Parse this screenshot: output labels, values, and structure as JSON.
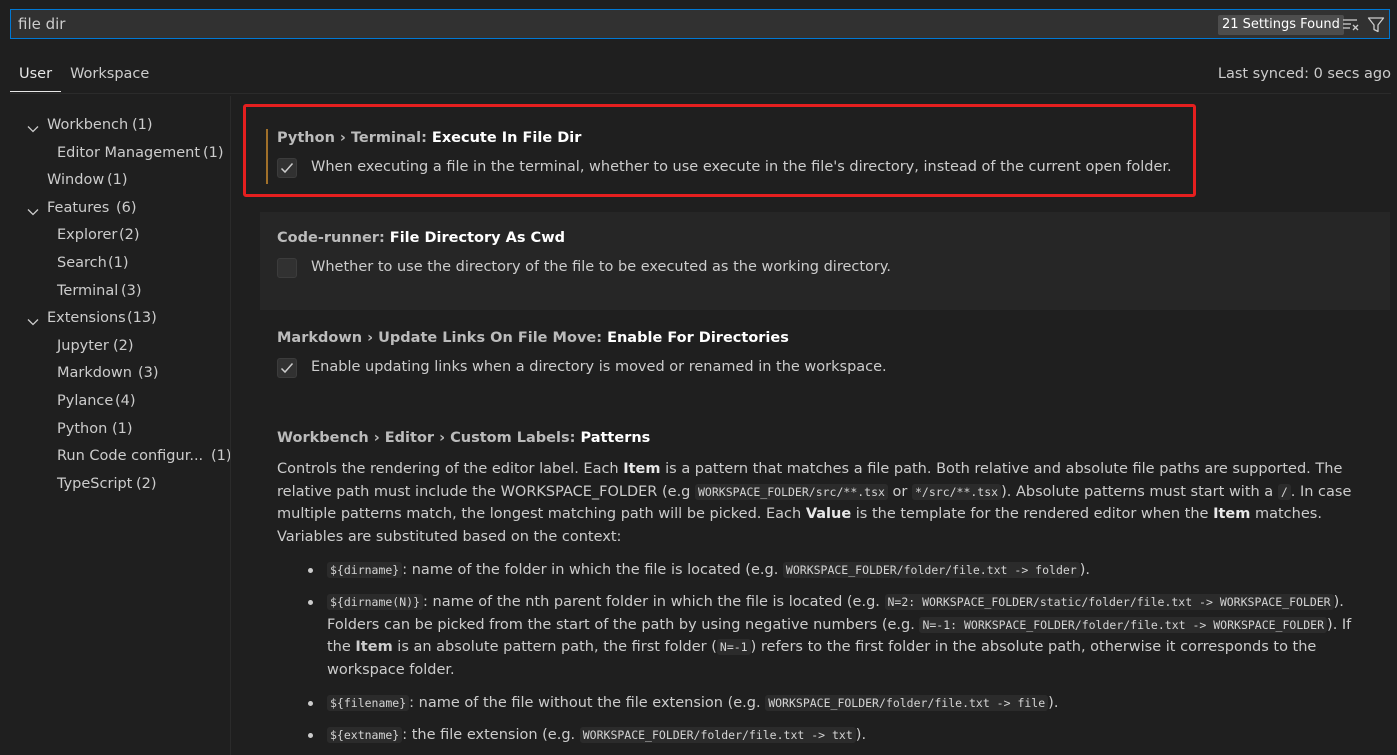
{
  "search": {
    "value": "file dir",
    "results_badge": "21 Settings Found"
  },
  "tabs": [
    {
      "label": "User",
      "active": true
    },
    {
      "label": "Workspace",
      "active": false
    }
  ],
  "sync_status": "Last synced: 0 secs ago",
  "toc": [
    {
      "label": "Workbench",
      "count": "(1)",
      "level": 0,
      "expanded": true
    },
    {
      "label": "Editor Management",
      "count": "(1)",
      "level": 1
    },
    {
      "label": "Window",
      "count": "(1)",
      "level": 0
    },
    {
      "label": "Features",
      "count": "(6)",
      "level": 0,
      "expanded": true
    },
    {
      "label": "Explorer",
      "count": "(2)",
      "level": 1
    },
    {
      "label": "Search",
      "count": "(1)",
      "level": 1
    },
    {
      "label": "Terminal",
      "count": "(3)",
      "level": 1
    },
    {
      "label": "Extensions",
      "count": "(13)",
      "level": 0,
      "expanded": true
    },
    {
      "label": "Jupyter",
      "count": "(2)",
      "level": 1
    },
    {
      "label": "Markdown",
      "count": "(3)",
      "level": 1
    },
    {
      "label": "Pylance",
      "count": "(4)",
      "level": 1
    },
    {
      "label": "Python",
      "count": "(1)",
      "level": 1
    },
    {
      "label": "Run Code configur...",
      "count": "(1)",
      "level": 1
    },
    {
      "label": "TypeScript",
      "count": "(2)",
      "level": 1
    }
  ],
  "settings": [
    {
      "category": "Python › Terminal: ",
      "name": "Execute In File Dir",
      "checked": true,
      "description": "When executing a file in the terminal, whether to use execute in the file's directory, instead of the current open folder."
    },
    {
      "category": "Code-runner: ",
      "name": "File Directory As Cwd",
      "checked": false,
      "description": "Whether to use the directory of the file to be executed as the working directory."
    },
    {
      "category": "Markdown › Update Links On File Move: ",
      "name": "Enable For Directories",
      "checked": true,
      "description": "Enable updating links when a directory is moved or renamed in the workspace."
    },
    {
      "category": "Workbench › Editor › Custom Labels: ",
      "name": "Patterns"
    }
  ],
  "patterns_desc": {
    "t1": "Controls the rendering of the editor label. Each ",
    "b1": "Item",
    "t2": " is a pattern that matches a file path. Both relative and absolute file paths are supported. The relative path must include the WORKSPACE_FOLDER (e.g ",
    "c1": "WORKSPACE_FOLDER/src/**.tsx",
    "t3": " or ",
    "c2": "*/src/**.tsx",
    "t4": "). Absolute patterns must start with a ",
    "c3": "/",
    "t5": ". In case multiple patterns match, the longest matching path will be picked. Each ",
    "b2": "Value",
    "t6": " is the template for the rendered editor when the ",
    "b3": "Item",
    "t7": " matches. Variables are substituted based on the context:"
  },
  "bullets": {
    "b1": {
      "var": "${dirname}",
      "text": ": name of the folder in which the file is located (e.g. ",
      "ex": "WORKSPACE_FOLDER/folder/file.txt -> folder",
      "end": ")."
    },
    "b2": {
      "var": "${dirname(N)}",
      "t1": ": name of the nth parent folder in which the file is located (e.g. ",
      "ex1": "N=2: WORKSPACE_FOLDER/static/folder/file.txt -> WORKSPACE_FOLDER",
      "t2": "). Folders can be picked from the start of the path by using negative numbers (e.g. ",
      "ex2": "N=-1: WORKSPACE_FOLDER/folder/file.txt -> WORKSPACE_FOLDER",
      "t3": "). If the ",
      "bold": "Item",
      "t4": " is an absolute pattern path, the first folder (",
      "ex3": "N=-1",
      "t5": ") refers to the first folder in the absolute path, otherwise it corresponds to the workspace folder."
    },
    "b3": {
      "var": "${filename}",
      "text": ": name of the file without the file extension (e.g. ",
      "ex": "WORKSPACE_FOLDER/folder/file.txt -> file",
      "end": ")."
    },
    "b4": {
      "var": "${extname}",
      "text": ": the file extension (e.g. ",
      "ex": "WORKSPACE_FOLDER/folder/file.txt -> txt",
      "end": ")."
    }
  },
  "colors": {
    "background": "#1f1f1f",
    "focus_border": "#0078d4",
    "highlight_border": "#e51f1f",
    "modified_indicator": "#a0702a"
  }
}
